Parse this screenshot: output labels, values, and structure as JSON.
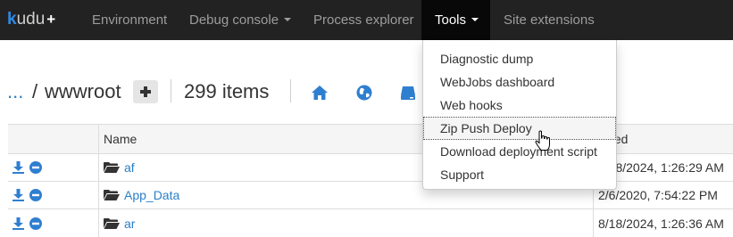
{
  "navbar": {
    "brand_k": "k",
    "brand_text": "udu",
    "brand_plus": "+",
    "items": [
      {
        "label": "Environment"
      },
      {
        "label": "Debug console"
      },
      {
        "label": "Process explorer"
      },
      {
        "label": "Tools"
      },
      {
        "label": "Site extensions"
      }
    ]
  },
  "path": {
    "parent": "...",
    "separator": "/",
    "current": "wwwroot",
    "item_count": "299 items"
  },
  "toolbar": {
    "icons": [
      "home-icon",
      "globe-icon",
      "drive-icon"
    ]
  },
  "table": {
    "columns": [
      "",
      "Name",
      "Modified"
    ],
    "visible_header_modified": "dified",
    "rows": [
      {
        "name": "af",
        "modified": "8/18/2024, 1:26:29 AM",
        "modified_visible": "8/18/2024, 1:26:29 AM"
      },
      {
        "name": "App_Data",
        "modified": "2/6/2020, 7:54:22 PM",
        "modified_visible": "2/6/2020, 7:54:22 PM"
      },
      {
        "name": "ar",
        "modified": "8/18/2024, 1:26:36 AM",
        "modified_visible": "8/18/2024, 1:26:36 AM"
      }
    ]
  },
  "tools_menu": {
    "items": [
      {
        "label": "Diagnostic dump"
      },
      {
        "label": "WebJobs dashboard"
      },
      {
        "label": "Web hooks"
      },
      {
        "label": "Zip Push Deploy"
      },
      {
        "label": "Download deployment script"
      },
      {
        "label": "Support"
      }
    ],
    "focused_index": 3
  },
  "colors": {
    "navbar_bg": "#222222",
    "link": "#2a7fc9",
    "accent_icon": "#2f7fd0"
  }
}
